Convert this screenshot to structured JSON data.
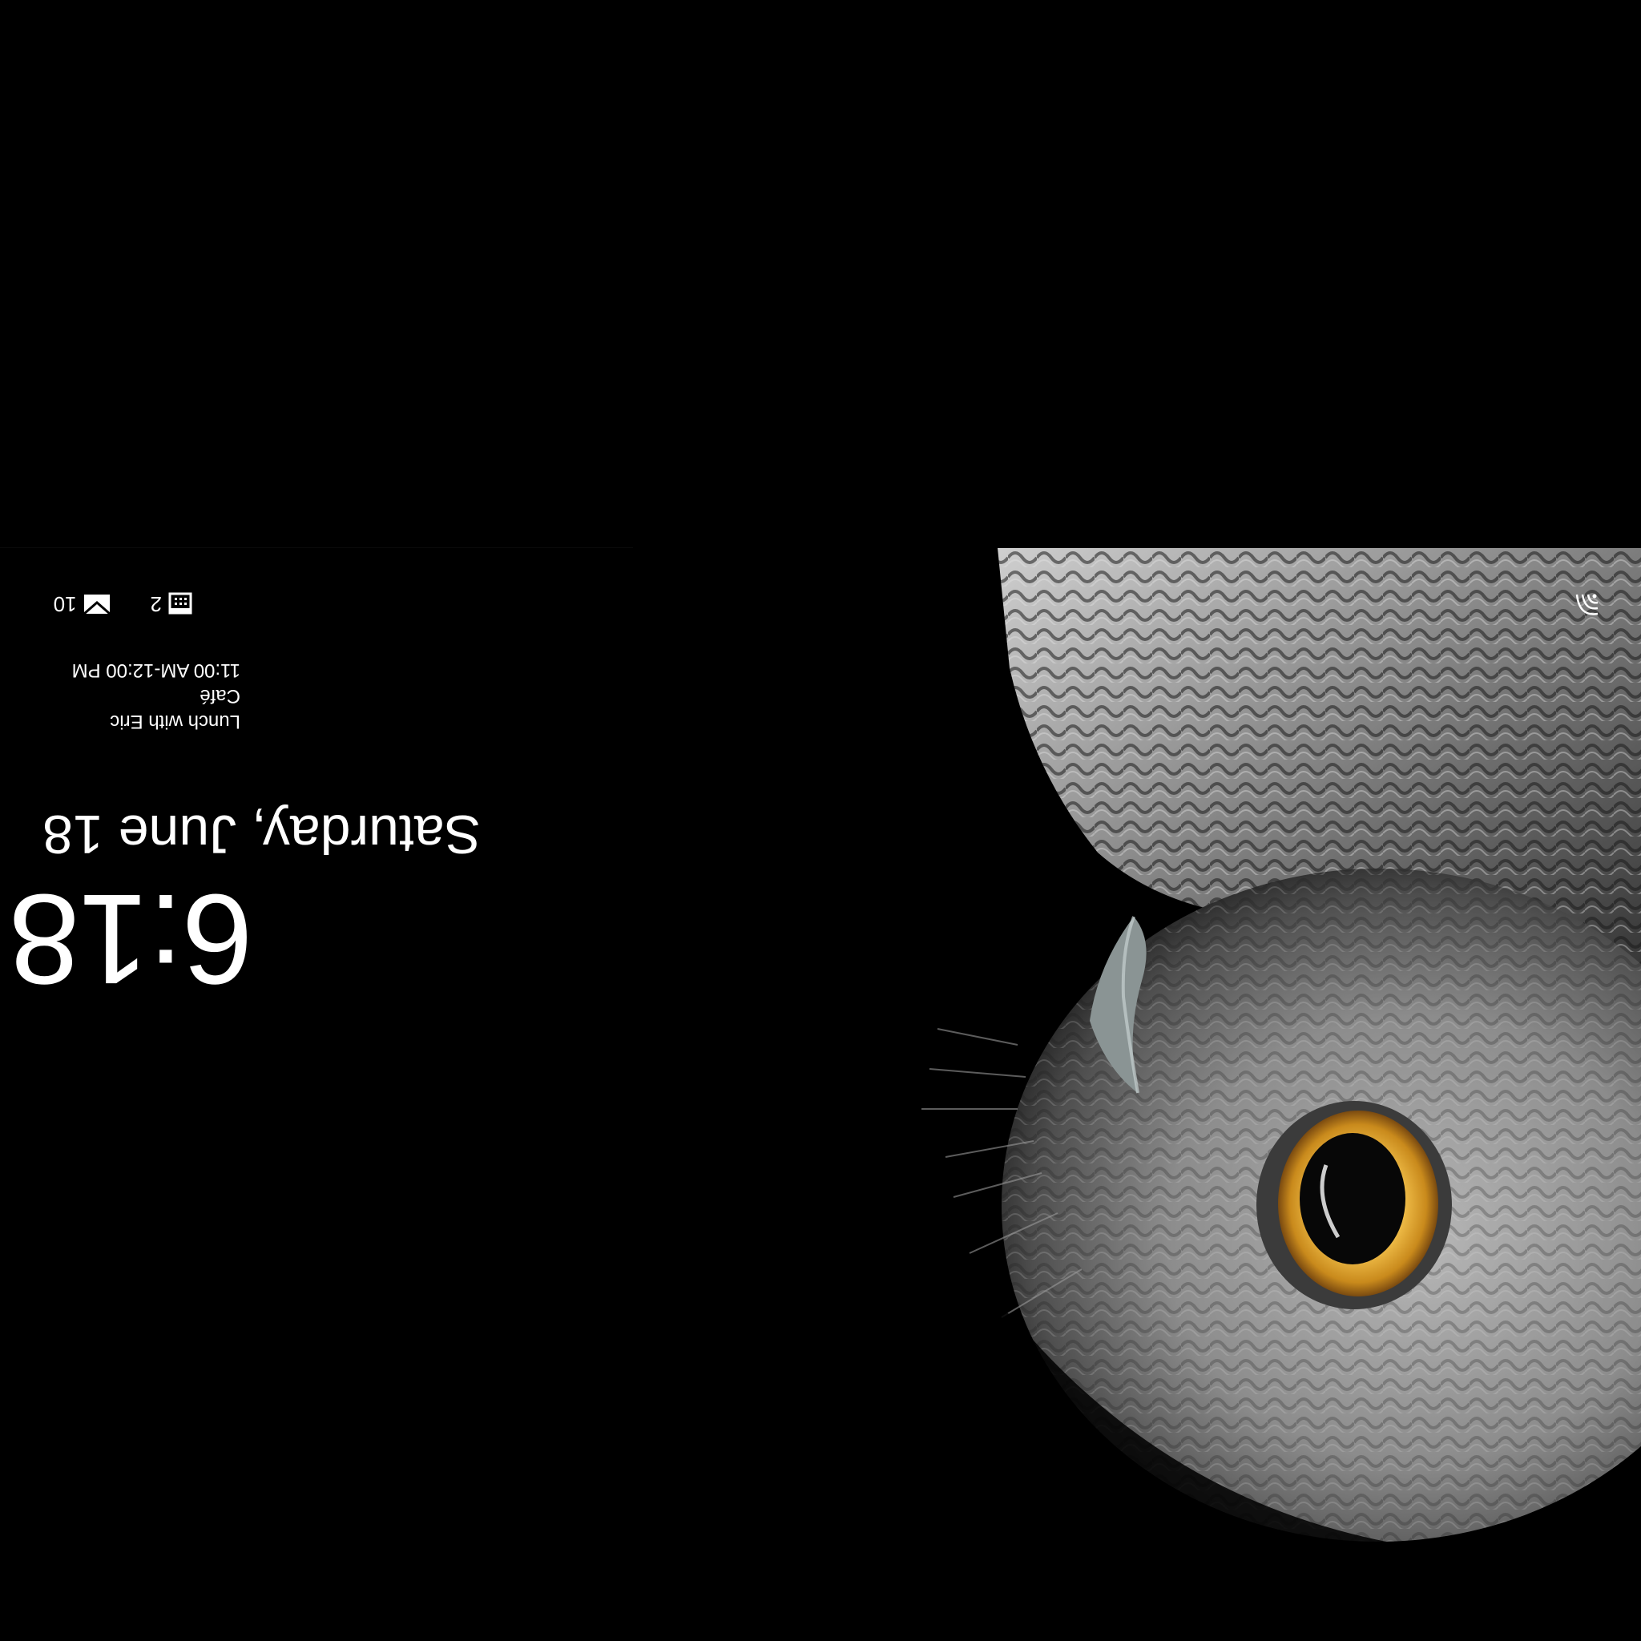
{
  "lock_screen": {
    "time": "6:18",
    "date": "Saturday, June 18",
    "event": {
      "title": "Lunch with Eric",
      "location": "Café",
      "time_range": "11:00 AM-12:00 PM"
    },
    "badges": {
      "calendar_count": "2",
      "mail_count": "10"
    },
    "icons": {
      "mail": "mail-icon",
      "calendar": "calendar-icon",
      "network": "wifi-icon"
    },
    "orientation": "upside-down"
  },
  "colors": {
    "background": "#000000",
    "text": "#ffffff",
    "owl_eye": "#e2a52a"
  }
}
